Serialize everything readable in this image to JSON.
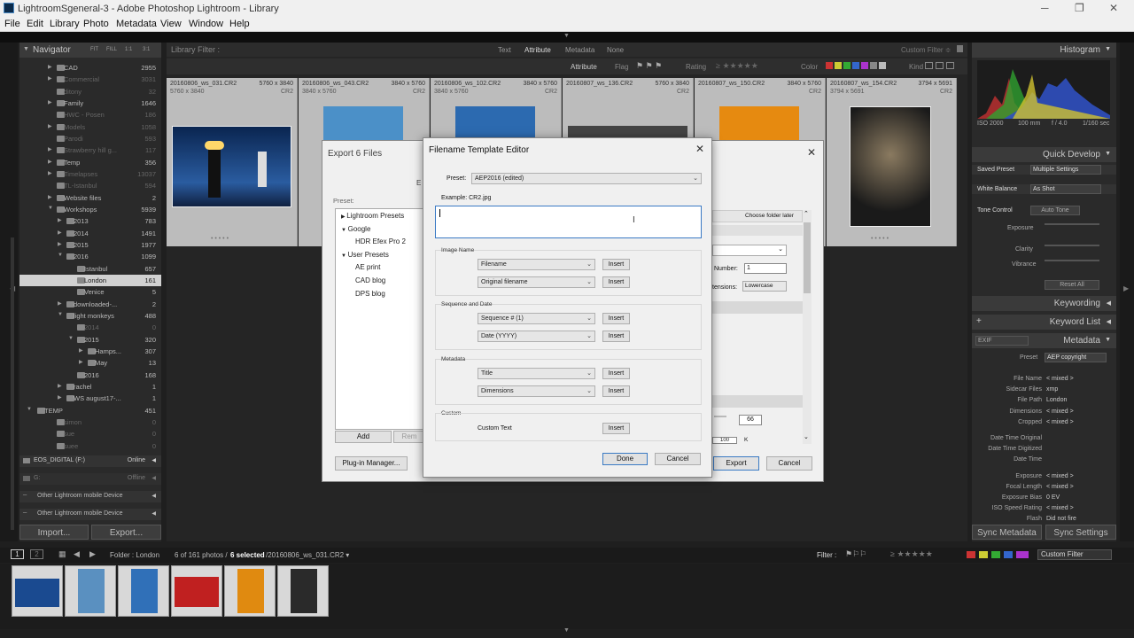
{
  "window": {
    "title": "LightroomSgeneral-3 - Adobe Photoshop Lightroom - Library"
  },
  "menu": [
    "File",
    "Edit",
    "Library",
    "Photo",
    "Metadata",
    "View",
    "Window",
    "Help"
  ],
  "navigator": {
    "title": "Navigator",
    "zoom": [
      "FIT",
      "FILL",
      "1:1",
      "3:1"
    ]
  },
  "folders": [
    {
      "name": "CAD",
      "count": "2955",
      "lvl": 2,
      "arr": "▶"
    },
    {
      "name": "Commercial",
      "count": "3031",
      "lvl": 2,
      "arr": "▶",
      "dim": true
    },
    {
      "name": "ditony",
      "count": "32",
      "lvl": 2,
      "arr": "",
      "dim": true
    },
    {
      "name": "Family",
      "count": "1646",
      "lvl": 2,
      "arr": "▶"
    },
    {
      "name": "HWC - Posen",
      "count": "186",
      "lvl": 2,
      "arr": "",
      "dim": true
    },
    {
      "name": "Models",
      "count": "1058",
      "lvl": 2,
      "arr": "▶",
      "dim": true
    },
    {
      "name": "Parodi",
      "count": "593",
      "lvl": 2,
      "arr": "",
      "dim": true
    },
    {
      "name": "Strawberry hill g...",
      "count": "117",
      "lvl": 2,
      "arr": "▶",
      "dim": true
    },
    {
      "name": "Temp",
      "count": "356",
      "lvl": 2,
      "arr": "▶"
    },
    {
      "name": "Timelapses",
      "count": "13037",
      "lvl": 2,
      "arr": "▶",
      "dim": true
    },
    {
      "name": "TL-Istanbul",
      "count": "594",
      "lvl": 2,
      "arr": "",
      "dim": true
    },
    {
      "name": "Website files",
      "count": "2",
      "lvl": 2,
      "arr": "▶"
    },
    {
      "name": "Workshops",
      "count": "5939",
      "lvl": 2,
      "arr": "▼"
    },
    {
      "name": "2013",
      "count": "783",
      "lvl": 3,
      "arr": "▶"
    },
    {
      "name": "2014",
      "count": "1491",
      "lvl": 3,
      "arr": "▶"
    },
    {
      "name": "2015",
      "count": "1977",
      "lvl": 3,
      "arr": "▶"
    },
    {
      "name": "2016",
      "count": "1099",
      "lvl": 3,
      "arr": "▼"
    },
    {
      "name": "Istanbul",
      "count": "657",
      "lvl": 4,
      "arr": ""
    },
    {
      "name": "London",
      "count": "161",
      "lvl": 4,
      "arr": "",
      "sel": true
    },
    {
      "name": "Venice",
      "count": "5",
      "lvl": 4,
      "arr": ""
    },
    {
      "name": "downloaded-...",
      "count": "2",
      "lvl": 3,
      "arr": "▶"
    },
    {
      "name": "light monkeys",
      "count": "488",
      "lvl": 3,
      "arr": "▼"
    },
    {
      "name": "2014",
      "count": "0",
      "lvl": 4,
      "arr": "",
      "dim": true
    },
    {
      "name": "2015",
      "count": "320",
      "lvl": 4,
      "arr": "▼"
    },
    {
      "name": "Hamps...",
      "count": "307",
      "lvl": 5,
      "arr": "▶"
    },
    {
      "name": "May",
      "count": "13",
      "lvl": 5,
      "arr": "▶"
    },
    {
      "name": "2016",
      "count": "168",
      "lvl": 4,
      "arr": ""
    },
    {
      "name": "rachel",
      "count": "1",
      "lvl": 3,
      "arr": "▶"
    },
    {
      "name": "WS august17-...",
      "count": "1",
      "lvl": 3,
      "arr": "▶"
    },
    {
      "name": "TEMP",
      "count": "451",
      "lvl": 1,
      "arr": "▼"
    },
    {
      "name": "simon",
      "count": "0",
      "lvl": 2,
      "arr": "",
      "dim": true
    },
    {
      "name": "sue",
      "count": "0",
      "lvl": 2,
      "arr": "",
      "dim": true
    },
    {
      "name": "suee",
      "count": "0",
      "lvl": 2,
      "arr": "",
      "dim": true
    }
  ],
  "volumes": [
    {
      "name": "EOS_DIGITAL (F:)",
      "status": "Online"
    },
    {
      "name": "G:",
      "status": "Offline"
    }
  ],
  "mobile": [
    "Other Lightroom mobile Device",
    "Other Lightroom mobile Device"
  ],
  "left_buttons": {
    "import": "Import...",
    "export": "Export..."
  },
  "filter": {
    "label": "Library Filter :",
    "tabs": [
      "Text",
      "Attribute",
      "Metadata",
      "None"
    ],
    "custom": "Custom Filter ≑"
  },
  "attrbar": {
    "attribute": "Attribute",
    "flag": "Flag",
    "rating": "Rating",
    "color": "Color",
    "kind": "Kind"
  },
  "grid": [
    {
      "file": "20160806_ws_031.CR2",
      "size": "5760 x 3840",
      "sub": "5760 x 3840",
      "ext": "CR2"
    },
    {
      "file": "20160806_ws_043.CR2",
      "size": "3840 x 5760",
      "sub": "3840 x 5760",
      "ext": "CR2"
    },
    {
      "file": "20160806_ws_102.CR2",
      "size": "3840 x 5760",
      "sub": "3840 x 5760",
      "ext": "CR2"
    },
    {
      "file": "20160807_ws_136.CR2",
      "size": "5760 x 3840",
      "sub": "",
      "ext": "CR2"
    },
    {
      "file": "20160807_ws_150.CR2",
      "size": "3840 x 5760",
      "sub": "",
      "ext": "CR2"
    },
    {
      "file": "20160807_ws_154.CR2",
      "size": "3794 x 5691",
      "sub": "3794 x 5691",
      "ext": "CR2"
    }
  ],
  "histogram": {
    "title": "Histogram",
    "iso": "ISO 2000",
    "focal": "100 mm",
    "aperture": "f / 4.0",
    "shutter": "1/160 sec"
  },
  "quick_develop": {
    "title": "Quick Develop",
    "saved_preset": "Saved Preset",
    "saved_value": "Multiple Settings",
    "white_balance": "White Balance",
    "wb_value": "As Shot",
    "tone": "Tone Control",
    "auto": "Auto Tone",
    "exposure": "Exposure",
    "clarity": "Clarity",
    "vibrance": "Vibrance",
    "reset": "Reset All"
  },
  "keywording": "Keywording",
  "keyword_list": "Keyword List",
  "metadata": {
    "title": "Metadata",
    "exif": "EXIF",
    "preset_lbl": "Preset",
    "preset": "AEP copyright",
    "rows": [
      [
        "File Name",
        "< mixed >"
      ],
      [
        "Sidecar Files",
        "xmp"
      ],
      [
        "File Path",
        "London"
      ],
      [
        "Dimensions",
        "< mixed >"
      ],
      [
        "Cropped",
        "< mixed >"
      ],
      [
        "Date Time Original",
        ""
      ],
      [
        "Date Time Digitized",
        ""
      ],
      [
        "Date Time",
        ""
      ],
      [
        "Exposure",
        "< mixed >"
      ],
      [
        "Focal Length",
        "< mixed >"
      ],
      [
        "Exposure Bias",
        "0 EV"
      ],
      [
        "ISO Speed Rating",
        "< mixed >"
      ],
      [
        "Flash",
        "Did not fire"
      ]
    ]
  },
  "sync": {
    "metadata": "Sync Metadata",
    "settings": "Sync Settings"
  },
  "bottom": {
    "folder": "Folder : London",
    "count": "6 of 161 photos /",
    "selected": "6 selected",
    "file": "/20160806_ws_031.CR2 ▾",
    "filter": "Filter :",
    "custom": "Custom Filter"
  },
  "export_dialog": {
    "title": "Export 6 Files",
    "preset": "Preset:",
    "presets": [
      {
        "name": "Lightroom Presets",
        "type": "folder",
        "open": false
      },
      {
        "name": "Google",
        "type": "folder",
        "open": true
      },
      {
        "name": "HDR Efex Pro 2",
        "type": "item"
      },
      {
        "name": "User Presets",
        "type": "folder",
        "open": true
      },
      {
        "name": "AE print",
        "type": "item"
      },
      {
        "name": "CAD blog",
        "type": "item"
      },
      {
        "name": "DPS blog",
        "type": "item"
      }
    ],
    "add": "Add",
    "remove": "Rem",
    "plugin": "Plug-in Manager...",
    "export": "Export",
    "cancel": "Cancel",
    "choose": "Choose folder later",
    "number_lbl": "Number:",
    "number": "1",
    "ext_lbl": "tensions:",
    "ext": "Lowercase",
    "quality": "66",
    "kval": "100",
    "k": "K",
    "e": "E"
  },
  "filename_editor": {
    "title": "Filename Template Editor",
    "preset_lbl": "Preset:",
    "preset": "AEP2016 (edited)",
    "example": "Example:  CR2.jpg",
    "sections": [
      {
        "title": "Image Name",
        "rows": [
          "Filename",
          "Original filename"
        ]
      },
      {
        "title": "Sequence and Date",
        "rows": [
          "Sequence # (1)",
          "Date (YYYY)"
        ]
      },
      {
        "title": "Metadata",
        "rows": [
          "Title",
          "Dimensions"
        ]
      }
    ],
    "custom_title": "Custom",
    "custom_text": "Custom Text",
    "insert": "Insert",
    "done": "Done",
    "cancel": "Cancel"
  }
}
